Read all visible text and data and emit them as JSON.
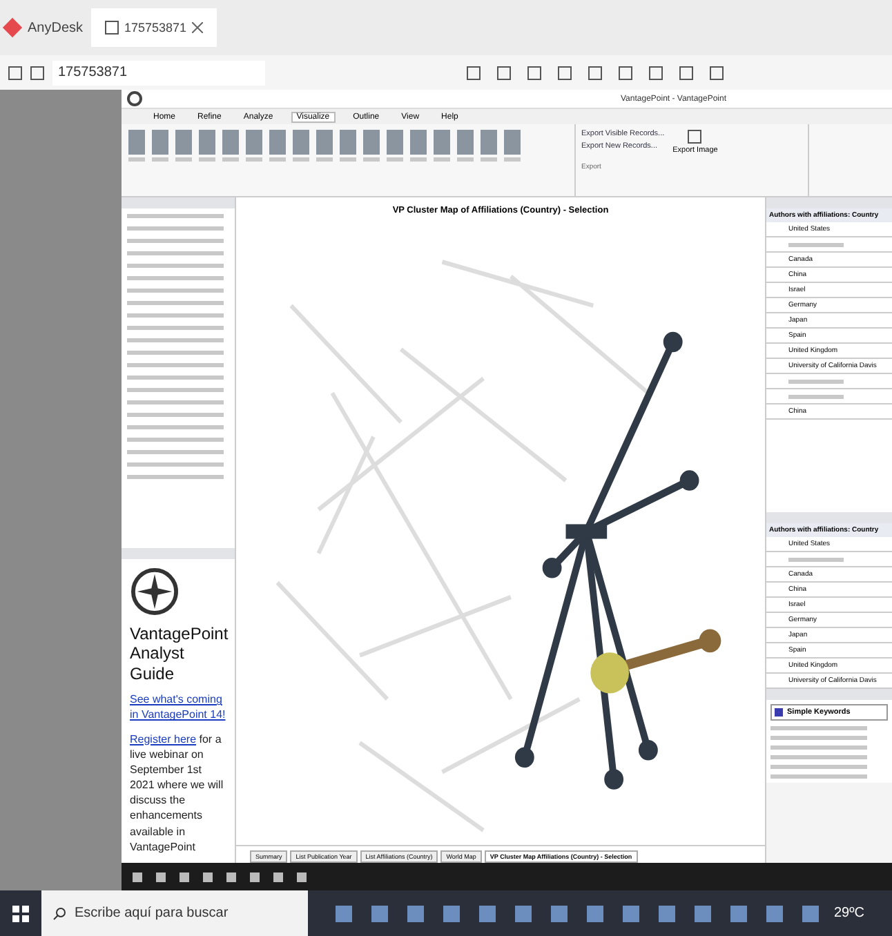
{
  "anydesk": {
    "app_name": "AnyDesk",
    "tab_label": "175753871",
    "address": "175753871"
  },
  "vp_window": {
    "title": "VantagePoint - VantagePoint",
    "menu": [
      {
        "label": "Home",
        "selected": false
      },
      {
        "label": "Refine",
        "selected": false
      },
      {
        "label": "Analyze",
        "selected": false
      },
      {
        "label": "Visualize",
        "selected": true
      },
      {
        "label": "Outline",
        "selected": false
      },
      {
        "label": "View",
        "selected": false
      },
      {
        "label": "Help",
        "selected": false
      }
    ]
  },
  "export": {
    "items": [
      "Export Visible Records...",
      "Export New Records..."
    ],
    "image_label": "Export Image",
    "group_label": "Export"
  },
  "guide": {
    "title": "VantagePoint Analyst Guide",
    "link": "See what's coming in VantagePoint 14!",
    "paragraph_link": "Register here",
    "paragraph_text": " for a live webinar on September 1st 2021 where we will discuss the enhancements available in VantagePoint"
  },
  "map": {
    "title": "VP Cluster Map of Affiliations (Country) - Selection"
  },
  "bottom_tabs": [
    {
      "label": "Summary",
      "selected": false
    },
    {
      "label": "List Publication Year",
      "selected": false
    },
    {
      "label": "List Affiliations (Country)",
      "selected": false
    },
    {
      "label": "World Map",
      "selected": false
    },
    {
      "label": "VP Cluster Map Affiliations (Country) - Selection",
      "selected": true
    }
  ],
  "detail_panels": [
    {
      "header": "Authors with affiliations: Country",
      "rows": [
        {
          "kind": "text",
          "label": "United States"
        },
        {
          "kind": "blurred"
        },
        {
          "kind": "text",
          "label": "Canada"
        },
        {
          "kind": "text",
          "label": "China"
        },
        {
          "kind": "text",
          "label": "Israel"
        },
        {
          "kind": "text",
          "label": "Germany"
        },
        {
          "kind": "text",
          "label": "Japan"
        },
        {
          "kind": "text",
          "label": "Spain"
        },
        {
          "kind": "text",
          "label": "United Kingdom"
        },
        {
          "kind": "text",
          "label": "University of California Davis"
        },
        {
          "kind": "blurred"
        },
        {
          "kind": "blurred"
        },
        {
          "kind": "text",
          "label": "China"
        }
      ]
    },
    {
      "header": "Authors with affiliations: Country",
      "rows": [
        {
          "kind": "text",
          "label": "United States"
        },
        {
          "kind": "blurred"
        },
        {
          "kind": "text",
          "label": "Canada"
        },
        {
          "kind": "text",
          "label": "China"
        },
        {
          "kind": "text",
          "label": "Israel"
        },
        {
          "kind": "text",
          "label": "Germany"
        },
        {
          "kind": "text",
          "label": "Japan"
        },
        {
          "kind": "text",
          "label": "Spain"
        },
        {
          "kind": "text",
          "label": "United Kingdom"
        },
        {
          "kind": "text",
          "label": "University of California Davis"
        }
      ]
    }
  ],
  "keywords": {
    "selector": "Simple Keywords"
  },
  "taskbar": {
    "search_placeholder": "Escribe aquí para buscar",
    "weather": "29ºC"
  }
}
